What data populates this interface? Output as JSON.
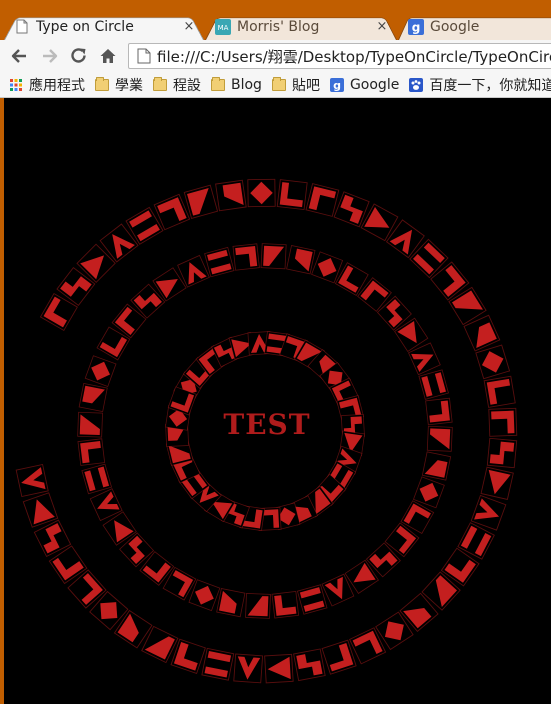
{
  "browser": {
    "tabs": [
      {
        "title": "Type on Circle",
        "active": true,
        "icon": "page-icon"
      },
      {
        "title": "Morris' Blog",
        "active": false,
        "icon": "blog-favicon-icon"
      },
      {
        "title": "Google",
        "active": false,
        "icon": "google-favicon-icon"
      }
    ],
    "tab_close_glyph": "×",
    "address": "file:///C:/Users/翔雲/Desktop/TypeOnCircle/TypeOnCircle.html",
    "bookmarks": [
      {
        "label": "應用程式",
        "icon": "apps-grid-icon"
      },
      {
        "label": "學業",
        "icon": "folder-icon"
      },
      {
        "label": "程設",
        "icon": "folder-icon"
      },
      {
        "label": "Blog",
        "icon": "folder-icon"
      },
      {
        "label": "貼吧",
        "icon": "folder-icon"
      },
      {
        "label": "Google",
        "icon": "google-icon"
      },
      {
        "label": "百度一下，你就知道",
        "icon": "baidu-icon"
      }
    ]
  },
  "page": {
    "center_text": "TEST",
    "glyph_color": "#c41f1f",
    "ring_glyph_counts": [
      44,
      40,
      32
    ]
  },
  "colors": {
    "tabstrip": "#c15e00",
    "toolbar": "#f6f6f6",
    "page_background": "#000000"
  }
}
